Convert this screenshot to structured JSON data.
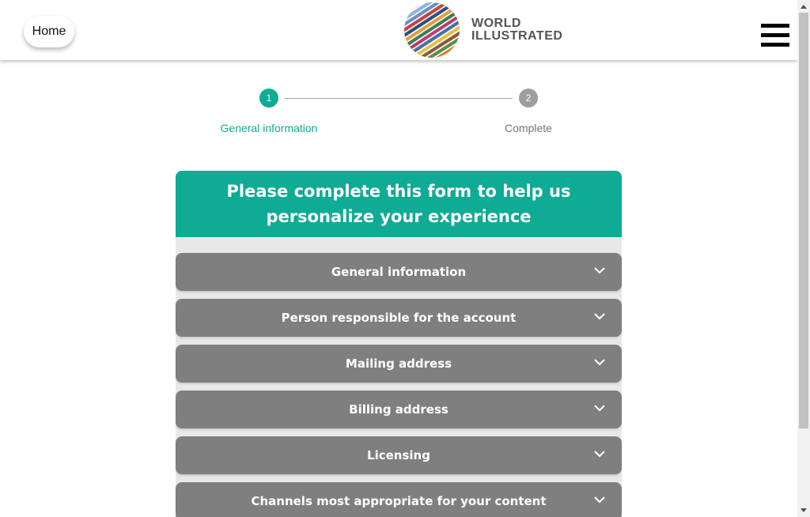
{
  "header": {
    "home_label": "Home",
    "logo": {
      "line1": "WORLD",
      "line2": "ILLUSTRATED",
      "icon": "globe-stripes-logo"
    },
    "menu_icon": "hamburger-menu-icon"
  },
  "stepper": {
    "steps": [
      {
        "number": "1",
        "label": "General information",
        "state": "active"
      },
      {
        "number": "2",
        "label": "Complete",
        "state": "inactive"
      }
    ]
  },
  "form": {
    "title": "Please complete this form to help us personalize your experience",
    "sections": [
      {
        "label": "General information"
      },
      {
        "label": "Person responsible for the account"
      },
      {
        "label": "Mailing address"
      },
      {
        "label": "Billing address"
      },
      {
        "label": "Licensing"
      },
      {
        "label": "Channels most appropriate for your content"
      }
    ],
    "expand_icon": "chevron-down-icon"
  },
  "colors": {
    "accent": "#0fab94",
    "section_bg": "#7f7f7f",
    "inactive_step": "#9e9e9e"
  }
}
